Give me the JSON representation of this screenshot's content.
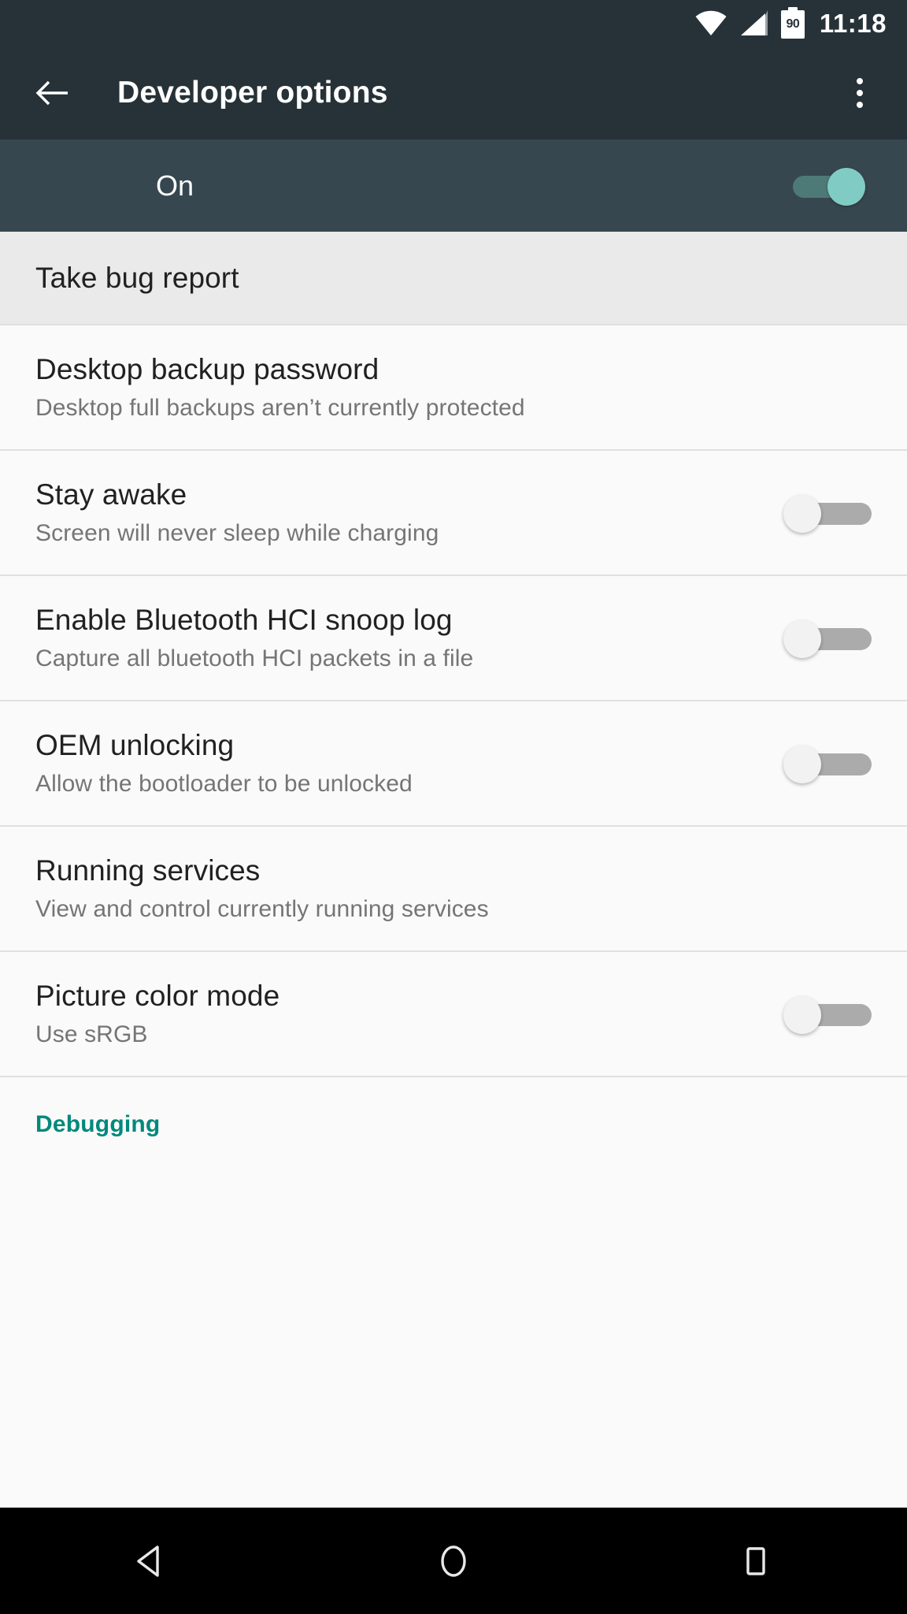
{
  "status_bar": {
    "wifi_icon": "wifi-icon",
    "signal_icon": "cell-signal-icon",
    "battery_icon": "battery-icon",
    "battery_level": "90",
    "time": "11:18"
  },
  "toolbar": {
    "back_icon": "back-arrow-icon",
    "title": "Developer options",
    "overflow_icon": "overflow-menu-icon"
  },
  "master_switch": {
    "label": "On",
    "state": "on"
  },
  "list": [
    {
      "title": "Take bug report",
      "subtitle": "",
      "has_switch": false,
      "switch_state": "",
      "shaded": true
    },
    {
      "title": "Desktop backup password",
      "subtitle": "Desktop full backups aren’t currently protected",
      "has_switch": false,
      "switch_state": "",
      "shaded": false
    },
    {
      "title": "Stay awake",
      "subtitle": "Screen will never sleep while charging",
      "has_switch": true,
      "switch_state": "off",
      "shaded": false
    },
    {
      "title": "Enable Bluetooth HCI snoop log",
      "subtitle": "Capture all bluetooth HCI packets in a file",
      "has_switch": true,
      "switch_state": "off",
      "shaded": false
    },
    {
      "title": "OEM unlocking",
      "subtitle": "Allow the bootloader to be unlocked",
      "has_switch": true,
      "switch_state": "off",
      "shaded": false
    },
    {
      "title": "Running services",
      "subtitle": "View and control currently running services",
      "has_switch": false,
      "switch_state": "",
      "shaded": false
    },
    {
      "title": "Picture color mode",
      "subtitle": "Use sRGB",
      "has_switch": true,
      "switch_state": "off",
      "shaded": false
    }
  ],
  "section_header": {
    "label": "Debugging"
  },
  "nav_bar": {
    "back_icon": "nav-back-triangle-icon",
    "home_icon": "nav-home-circle-icon",
    "recents_icon": "nav-recents-square-icon"
  },
  "colors": {
    "status_bar_bg": "#263238",
    "toolbar_bg": "#263238",
    "master_bar_bg": "#37474F",
    "accent_teal": "#00897B",
    "switch_on_thumb": "#80CBC4",
    "switch_off_thumb": "#F2F2F2",
    "list_bg": "#FAFAFA",
    "shaded_row_bg": "#EAEAEA",
    "nav_bar_bg": "#000000",
    "title_text": "#212121",
    "subtitle_text": "#757575"
  }
}
